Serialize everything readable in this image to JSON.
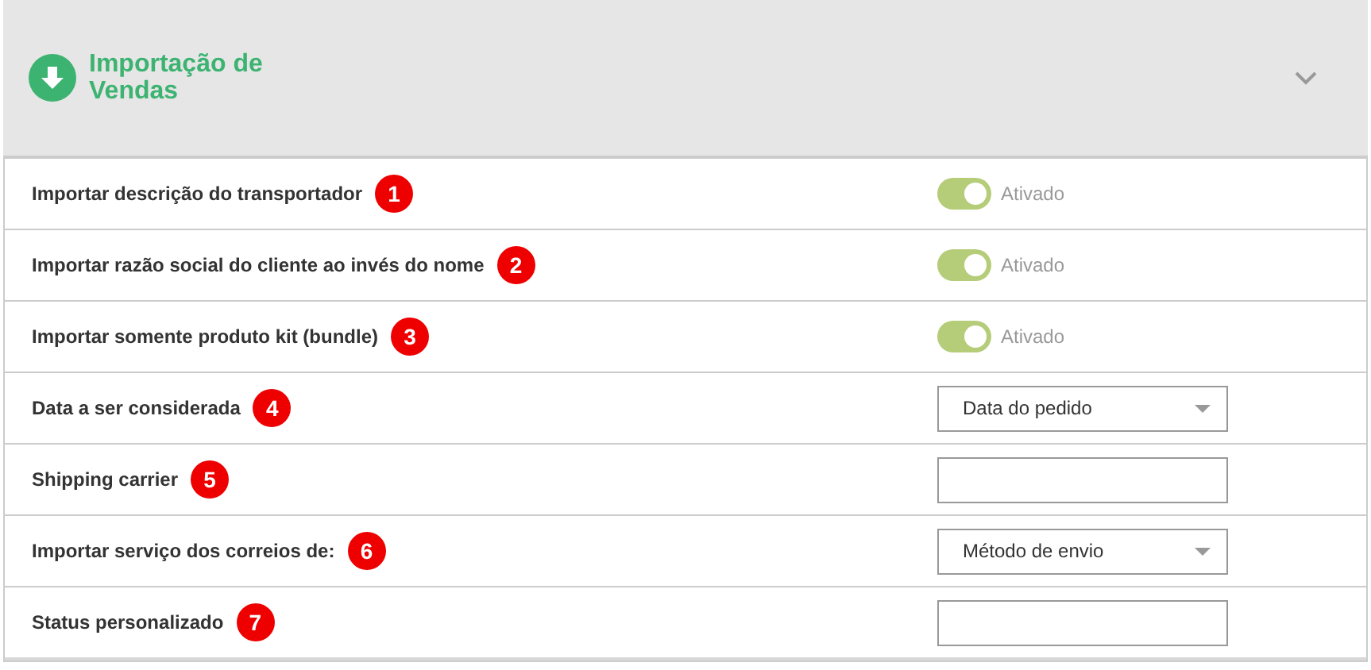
{
  "panel": {
    "title": "Importação de Vendas",
    "expanded": true
  },
  "settings": [
    {
      "label": "Importar descrição do transportador",
      "badge": "1",
      "kind": "toggle",
      "on": true,
      "state_label": "Ativado"
    },
    {
      "label": "Importar razão social do cliente ao invés do nome",
      "badge": "2",
      "kind": "toggle",
      "on": true,
      "state_label": "Ativado"
    },
    {
      "label": "Importar somente produto kit (bundle)",
      "badge": "3",
      "kind": "toggle",
      "on": true,
      "state_label": "Ativado"
    },
    {
      "label": "Data a ser considerada",
      "badge": "4",
      "kind": "select",
      "value": "Data do pedido"
    },
    {
      "label": "Shipping carrier",
      "badge": "5",
      "kind": "input"
    },
    {
      "label": "Importar serviço dos correios de:",
      "badge": "6",
      "kind": "select",
      "value": "Método de envio"
    },
    {
      "label": "Status personalizado",
      "badge": "7",
      "kind": "input"
    }
  ]
}
